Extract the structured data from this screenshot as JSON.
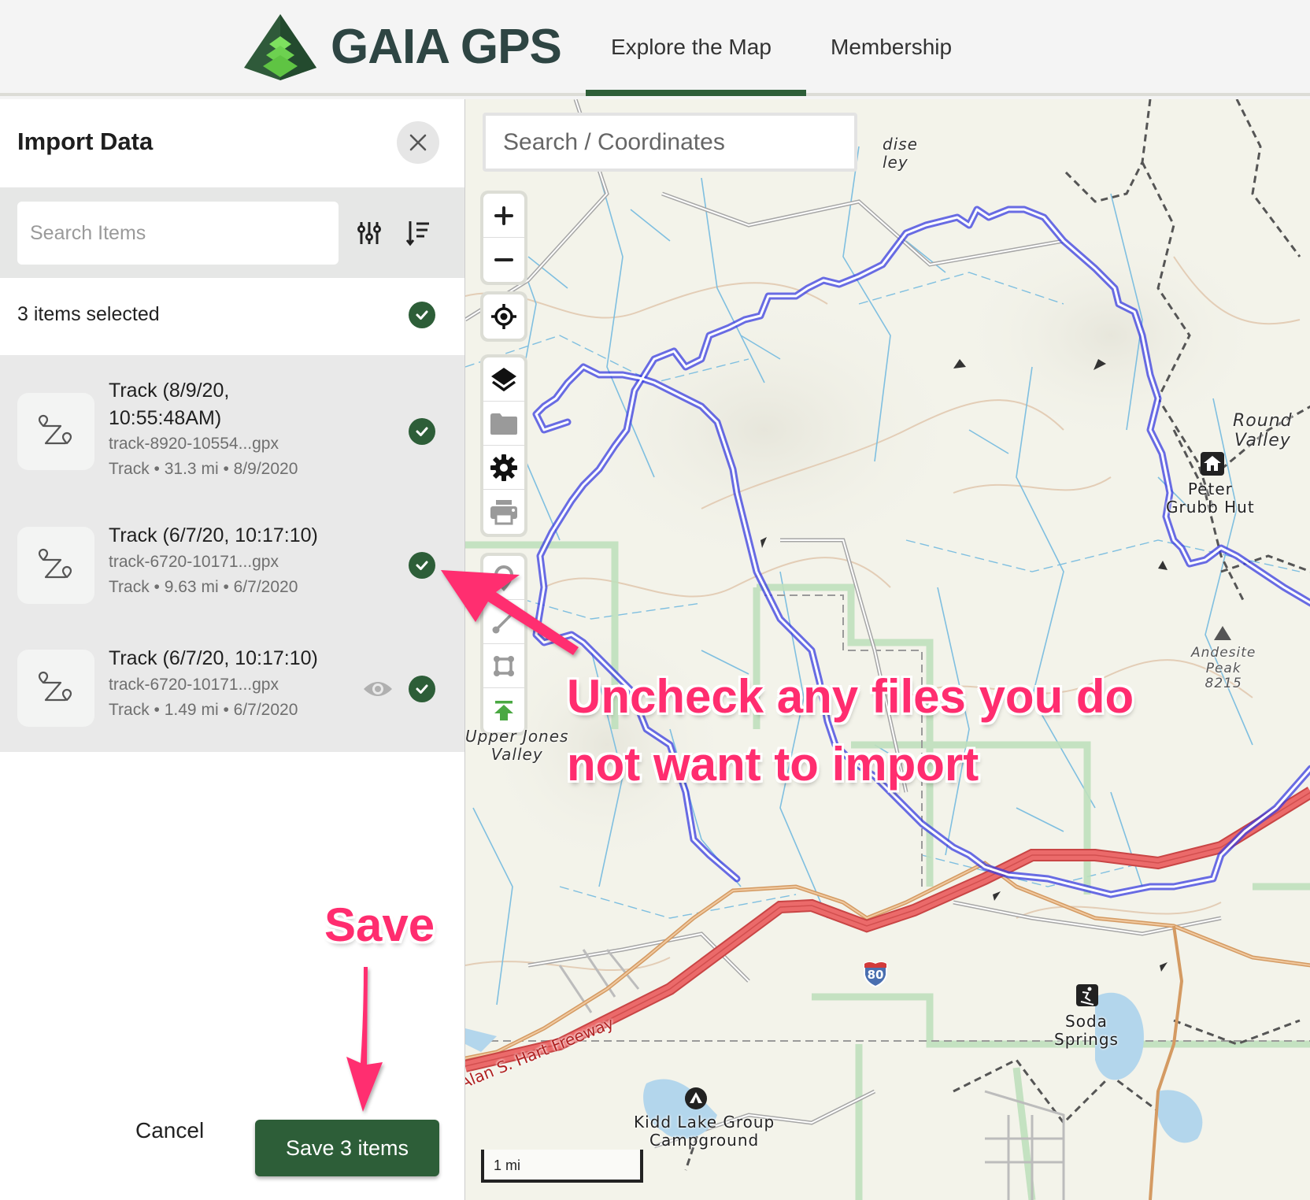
{
  "header": {
    "brand": "GAIA GPS",
    "nav": [
      {
        "label": "Explore the Map",
        "active": true
      },
      {
        "label": "Membership",
        "active": false
      }
    ]
  },
  "sidebar": {
    "title": "Import Data",
    "search_placeholder": "Search Items",
    "selected_text": "3 items selected",
    "items": [
      {
        "title": "Track (8/9/20, 10:55:48AM)",
        "file": "track-8920-10554...gpx",
        "meta": "Track • 31.3 mi • 8/9/2020",
        "checked": true,
        "show_eye": false
      },
      {
        "title": "Track (6/7/20, 10:17:10)",
        "file": "track-6720-10171...gpx",
        "meta": "Track • 9.63 mi • 6/7/2020",
        "checked": true,
        "show_eye": false
      },
      {
        "title": "Track (6/7/20, 10:17:10)",
        "file": "track-6720-10171...gpx",
        "meta": "Track • 1.49 mi • 6/7/2020",
        "checked": true,
        "show_eye": true
      }
    ],
    "cancel_label": "Cancel",
    "save_label": "Save 3 items"
  },
  "map": {
    "search_placeholder": "Search / Coordinates",
    "controls": [
      "zoom-in",
      "zoom-out",
      "locate",
      "layers",
      "folder",
      "settings",
      "print",
      "waypoint",
      "route",
      "area",
      "upload"
    ],
    "labels": {
      "paradise_valley": "dise\nley",
      "round_valley": "Round\nValley",
      "peter_grubb_hut": "Peter\nGrubb Hut",
      "andesite_peak": "Andesite\nPeak\n8215",
      "upper_jones_valley": "Upper Jones\nValley",
      "soda_springs": "Soda\nSprings",
      "kidd_lake": "Kidd Lake Group\nCampground",
      "freeway": "Alan S. Hart Freeway",
      "interstate": "80"
    },
    "scale_label": "1 mi"
  },
  "annotations": {
    "main": "Uncheck any files you do not want to import",
    "main_line1": "Uncheck any files you do",
    "main_line2": "not want to import",
    "save": "Save"
  },
  "colors": {
    "brand_green": "#2d5e38",
    "annotation_pink": "#ff2d6f",
    "track_blue": "#2b2fd1",
    "freeway_red": "#e55a5a"
  }
}
